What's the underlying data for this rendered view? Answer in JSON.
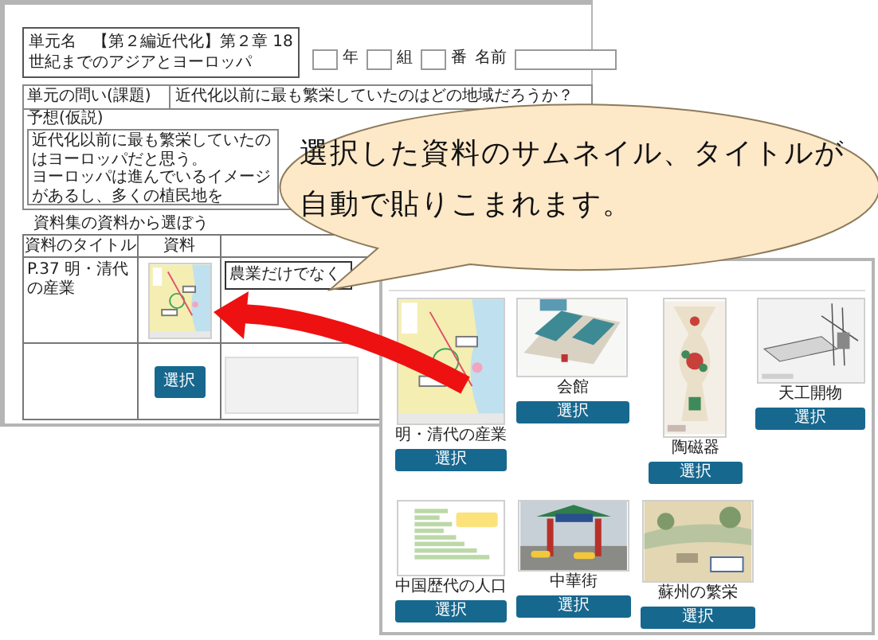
{
  "worksheet": {
    "unit_name_lines": [
      "単元名　【第２編近代化】第２章 18",
      "世紀までのアジアとヨーロッパ"
    ],
    "name_fields": [
      {
        "label": "年",
        "kind": "box_before"
      },
      {
        "label": "組",
        "kind": "box_before"
      },
      {
        "label": "番",
        "kind": "box_before"
      },
      {
        "label": "名前",
        "kind": "box_after"
      }
    ],
    "question": {
      "label": "単元の問い(課題)",
      "text": "近代化以前に最も繁栄していたのはどの地域だろうか？"
    },
    "hypothesis": {
      "label": "予想(仮説)",
      "lines": [
        "近代化以前に最も繁栄していたのはヨーロッパだと思う。",
        "ヨーロッパは進んでいるイメージがあるし、多くの植民地を"
      ]
    },
    "materials_table": {
      "caption": "資料集の資料から選ぼう",
      "columns": [
        "資料のタイトル",
        "資料"
      ],
      "rows": [
        {
          "kind": "entry",
          "title": "P.37 明・清代の産業",
          "note": "農業だけでなく"
        },
        {
          "kind": "select",
          "button": "選択"
        }
      ]
    }
  },
  "callout": {
    "lines": [
      "選択した資料のサムネイル、タイトルが",
      "自動で貼りこまれます。"
    ]
  },
  "gallery": {
    "rows": [
      [
        {
          "caption": "明・清代の産業",
          "button": "選択"
        },
        {
          "caption": "会館",
          "button": "選択"
        },
        {
          "caption": "陶磁器",
          "button": "選択"
        },
        {
          "caption": "天工開物",
          "button": "選択"
        }
      ],
      [
        {
          "caption": "中国歴代の人口",
          "button": "選択"
        },
        {
          "caption": "中華街",
          "button": "選択"
        },
        {
          "caption": "蘇州の繁栄",
          "button": "選択"
        }
      ]
    ]
  }
}
